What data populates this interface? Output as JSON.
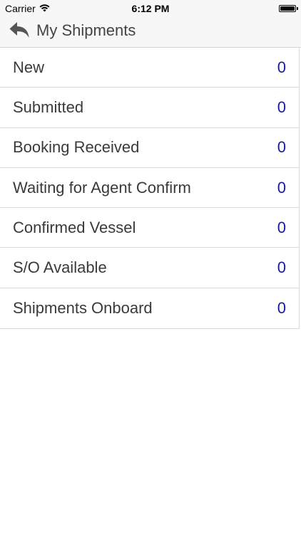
{
  "status_bar": {
    "carrier": "Carrier",
    "time": "6:12 PM",
    "wifi_icon": "wifi-icon",
    "battery_icon": "battery-icon"
  },
  "nav": {
    "back_icon": "reply-back-arrow-icon",
    "title": "My Shipments"
  },
  "shipment_statuses": [
    {
      "label": "New",
      "count": "0"
    },
    {
      "label": "Submitted",
      "count": "0"
    },
    {
      "label": "Booking Received",
      "count": "0"
    },
    {
      "label": "Waiting for Agent Confirm",
      "count": "0"
    },
    {
      "label": "Confirmed Vessel",
      "count": "0"
    },
    {
      "label": "S/O Available",
      "count": "0"
    },
    {
      "label": "Shipments Onboard",
      "count": "0"
    }
  ],
  "colors": {
    "count_color": "#1a1aa0",
    "nav_background": "#f7f7f7",
    "separator": "#d9d9d9"
  }
}
